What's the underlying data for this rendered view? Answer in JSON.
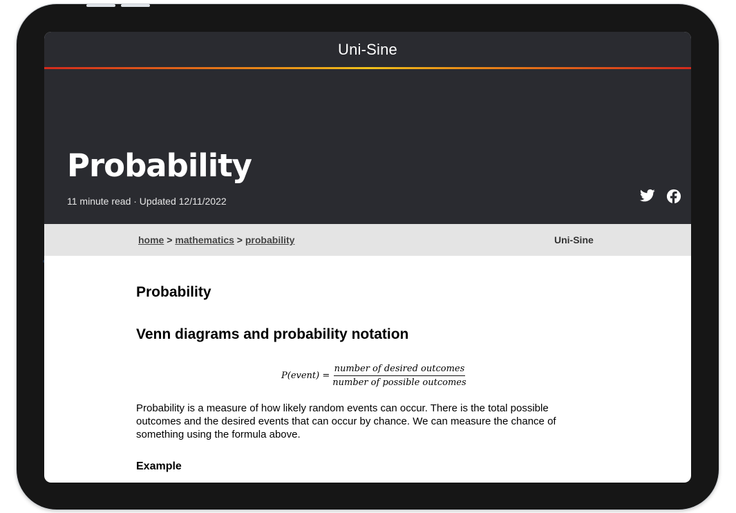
{
  "site": {
    "title": "Uni-Sine"
  },
  "hero": {
    "title": "Probability",
    "meta": "11 minute read · Updated 12/11/2022"
  },
  "breadcrumb": {
    "items": [
      "home",
      "mathematics",
      "probability"
    ],
    "separator": ">",
    "brand": "Uni-Sine"
  },
  "content": {
    "heading": "Probability",
    "subheading": "Venn diagrams and probability notation",
    "formula": {
      "lhs": "P(event) =",
      "numerator": "number of desired outcomes",
      "denominator": "number of possible outcomes"
    },
    "paragraph": "Probability is a measure of how likely random events can occur. There is the total possible outcomes and the desired events that can occur by chance. We can measure the chance of something using the formula above.",
    "example_heading": "Example"
  },
  "icons": {
    "twitter": "twitter-icon",
    "facebook": "facebook-icon"
  },
  "colors": {
    "header_bg": "#2a2b30",
    "accent_gradient": [
      "#d42a1c",
      "#f1c21a"
    ],
    "crumb_bg": "#e4e4e4"
  }
}
